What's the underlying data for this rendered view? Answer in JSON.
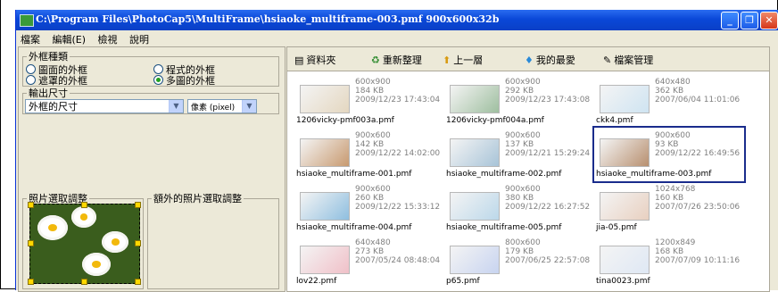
{
  "window": {
    "title": "C:\\Program Files\\PhotoCap5\\MultiFrame\\hsiaoke_multiframe-003.pmf   900x600x32b",
    "buttons": {
      "minimize": "_",
      "restore": "❐",
      "close": "✕"
    }
  },
  "menu": [
    "檔案",
    "編輯(E)",
    "檢視",
    "說明"
  ],
  "left_panel": {
    "frame_type": {
      "legend": "外框種類",
      "options": [
        {
          "label": "圖面的外框",
          "selected": false
        },
        {
          "label": "程式的外框",
          "selected": false
        },
        {
          "label": "遮罩的外框",
          "selected": false
        },
        {
          "label": "多圖的外框",
          "selected": true
        }
      ]
    },
    "output_size": {
      "legend": "輸出尺寸",
      "size_select": "外框的尺寸",
      "unit_select": "像素 (pixel)"
    },
    "photo_adjust": {
      "legend": "照片選取調整"
    },
    "extra_photo_adjust": {
      "legend": "額外的照片選取調整"
    }
  },
  "toolbar": [
    {
      "icon": "folder-icon",
      "glyph": "▤",
      "label": "資料夾"
    },
    {
      "icon": "refresh-icon",
      "glyph": "♻",
      "label": "重新整理"
    },
    {
      "icon": "up-icon",
      "glyph": "⬆",
      "label": "上一層"
    },
    {
      "icon": "favorites-icon",
      "glyph": "♦",
      "label": "我的最愛"
    },
    {
      "icon": "file-manager-icon",
      "glyph": "✎",
      "label": "檔案管理"
    }
  ],
  "files": [
    {
      "name": "1206vicky-pmf003a.pmf",
      "dims": "600x900",
      "size": "184 KB",
      "date": "2009/12/23 17:43:04",
      "selected": false
    },
    {
      "name": "1206vicky-pmf004a.pmf",
      "dims": "600x900",
      "size": "292 KB",
      "date": "2009/12/23 17:43:08",
      "selected": false
    },
    {
      "name": "ckk4.pmf",
      "dims": "640x480",
      "size": "362 KB",
      "date": "2007/06/04 11:01:06",
      "selected": false
    },
    {
      "name": "hsiaoke_multiframe-001.pmf",
      "dims": "900x600",
      "size": "142 KB",
      "date": "2009/12/22 14:02:00",
      "selected": false
    },
    {
      "name": "hsiaoke_multiframe-002.pmf",
      "dims": "900x600",
      "size": "137 KB",
      "date": "2009/12/21 15:29:24",
      "selected": false
    },
    {
      "name": "hsiaoke_multiframe-003.pmf",
      "dims": "900x600",
      "size": "93 KB",
      "date": "2009/12/22 16:49:56",
      "selected": true
    },
    {
      "name": "hsiaoke_multiframe-004.pmf",
      "dims": "900x600",
      "size": "260 KB",
      "date": "2009/12/22 15:33:12",
      "selected": false
    },
    {
      "name": "hsiaoke_multiframe-005.pmf",
      "dims": "900x600",
      "size": "380 KB",
      "date": "2009/12/22 16:27:52",
      "selected": false
    },
    {
      "name": "jia-05.pmf",
      "dims": "1024x768",
      "size": "160 KB",
      "date": "2007/07/26 23:50:06",
      "selected": false
    },
    {
      "name": "lov22.pmf",
      "dims": "640x480",
      "size": "273 KB",
      "date": "2007/05/24 08:48:04",
      "selected": false
    },
    {
      "name": "p65.pmf",
      "dims": "800x600",
      "size": "179 KB",
      "date": "2007/06/25 22:57:08",
      "selected": false
    },
    {
      "name": "tina0023.pmf",
      "dims": "1200x849",
      "size": "168 KB",
      "date": "2007/07/09 10:11:16",
      "selected": false
    }
  ]
}
